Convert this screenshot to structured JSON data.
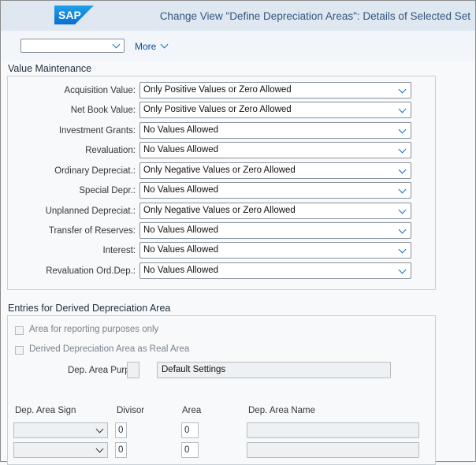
{
  "shell": {
    "logo_text": "SAP",
    "brand_color": "#0a6ed1",
    "title": "Change View \"Define Depreciation Areas\": Details of Selected Set"
  },
  "toolbar": {
    "selector_value": "",
    "more_label": "More"
  },
  "value_maintenance": {
    "title": "Value Maintenance",
    "rows": [
      {
        "label": "Acquisition Value:",
        "value": "Only Positive Values or Zero Allowed"
      },
      {
        "label": "Net Book Value:",
        "value": "Only Positive Values or Zero Allowed"
      },
      {
        "label": "Investment Grants:",
        "value": "No Values Allowed"
      },
      {
        "label": "Revaluation:",
        "value": "No Values Allowed"
      },
      {
        "label": "Ordinary Depreciat.:",
        "value": "Only Negative Values or Zero Allowed"
      },
      {
        "label": "Special Depr.:",
        "value": "No Values Allowed"
      },
      {
        "label": "Unplanned Depreciat.:",
        "value": "Only Negative Values or Zero Allowed"
      },
      {
        "label": "Transfer of Reserves:",
        "value": "No Values Allowed"
      },
      {
        "label": "Interest:",
        "value": "No Values Allowed"
      },
      {
        "label": "Revaluation Ord.Dep.:",
        "value": "No Values Allowed"
      }
    ]
  },
  "derived": {
    "title": "Entries for Derived Depreciation Area",
    "checkbox_reporting": "Area for reporting purposes only",
    "checkbox_real_area": "Derived Depreciation Area as Real Area",
    "purpose_label": "Dep. Area Purp.:",
    "purpose_code": "",
    "purpose_text": "Default Settings",
    "columns": [
      "Dep. Area Sign",
      "Divisor",
      "Area",
      "Dep. Area Name"
    ],
    "rows": [
      {
        "sign": "",
        "divisor": "0",
        "area": "0",
        "name": ""
      },
      {
        "sign": "",
        "divisor": "0",
        "area": "0",
        "name": ""
      }
    ]
  }
}
